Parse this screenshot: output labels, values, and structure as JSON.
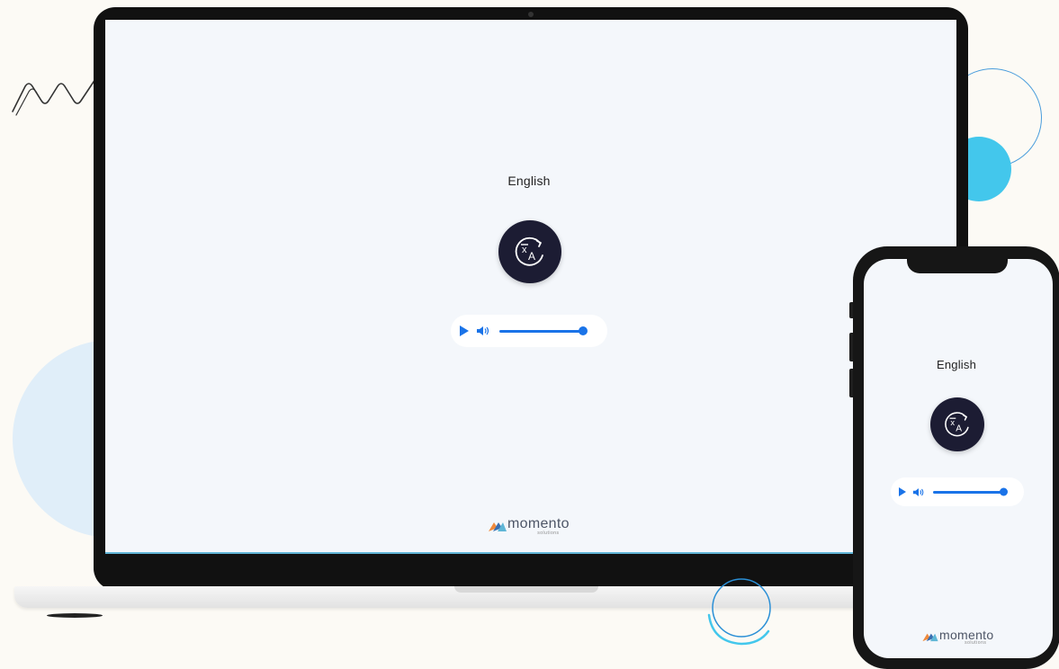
{
  "laptop": {
    "language_label": "English",
    "translate_icon": "translate-icon",
    "player": {
      "play_icon": "play-icon",
      "volume_icon": "volume-icon",
      "progress": 1.0
    },
    "logo": {
      "name": "momento",
      "tagline": "solutions"
    }
  },
  "phone": {
    "language_label": "English",
    "translate_icon": "translate-icon",
    "player": {
      "play_icon": "play-icon",
      "volume_icon": "volume-icon",
      "progress": 1.0
    },
    "logo": {
      "name": "momento",
      "tagline": "solutions"
    }
  },
  "colors": {
    "accent": "#1a73e8",
    "button_bg": "#1c1c33",
    "screen_bg": "#f4f7fb",
    "page_bg": "#fcfaf5",
    "deco_light_blue": "#e0eef9",
    "deco_cyan": "#43c7ec"
  }
}
